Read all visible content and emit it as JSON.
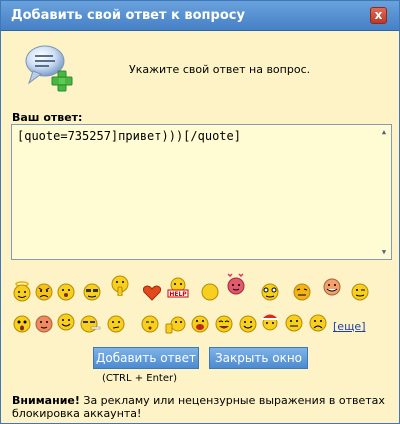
{
  "window": {
    "title": "Добавить свой ответ к вопросу",
    "close_glyph": "x"
  },
  "header": {
    "icon": "chat-bubble-add-icon",
    "prompt": "Укажите свой ответ на вопрос."
  },
  "form": {
    "answer_label": "Ваш ответ:",
    "answer_value": "[quote=735257]привет)))[/quote]"
  },
  "smileys": {
    "icons": [
      "smiley-angel-icon",
      "smiley-angry-icon",
      "smiley-surprised-icon",
      "smiley-cool-icon",
      "smiley-shush-icon",
      "heart-icon",
      "smiley-help-icon",
      "smiley-blank-icon",
      "smiley-in-love-icon",
      "smiley-crazy-icon",
      "smiley-idea-icon",
      "smiley-rofl-icon",
      "smiley-wink-icon",
      "smiley-shocked-icon",
      "smiley-blush-icon",
      "smiley-smile-icon",
      "smiley-smoking-icon",
      "smiley-thinking-icon",
      "smiley-whistle-icon",
      "smiley-thumbsup-icon",
      "smiley-yell-icon",
      "smiley-laugh-icon",
      "smiley-happy-icon",
      "smiley-santa-icon",
      "smiley-grin-icon",
      "smiley-sad-icon"
    ],
    "more_label": "еще"
  },
  "buttons": {
    "submit_label": "Добавить ответ",
    "close_label": "Закрыть окно",
    "hint": "(CTRL + Enter)"
  },
  "warning": {
    "prefix": "Внимание!",
    "text": " За рекламу или нецензурные выражения в ответах блокировка аккаунта!"
  },
  "colors": {
    "titlebar": "#4f8bd0",
    "background": "#fdf3c6",
    "button": "#5c98d8",
    "link": "#1f3fa6"
  }
}
